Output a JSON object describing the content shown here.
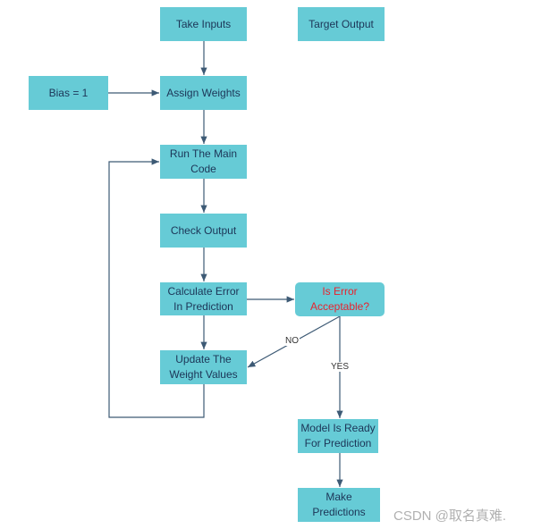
{
  "nodes": {
    "take_inputs": "Take Inputs",
    "target_output": "Target Output",
    "bias": "Bias = 1",
    "assign_weights": "Assign Weights",
    "run_main_code": "Run The Main\nCode",
    "check_output": "Check Output",
    "calculate_error": "Calculate Error\nIn Prediction",
    "is_error_acceptable": "Is Error\nAcceptable?",
    "update_weights": "Update The\nWeight Values",
    "model_ready": "Model Is Ready\nFor Prediction",
    "make_predictions": "Make\nPredictions"
  },
  "edges": {
    "no_label": "NO",
    "yes_label": "YES"
  },
  "colors": {
    "box": "#66cbd6",
    "text": "#1c3557",
    "decision_text": "#e8232e",
    "line": "#3d5a75"
  },
  "watermark": "CSDN @取名真难."
}
